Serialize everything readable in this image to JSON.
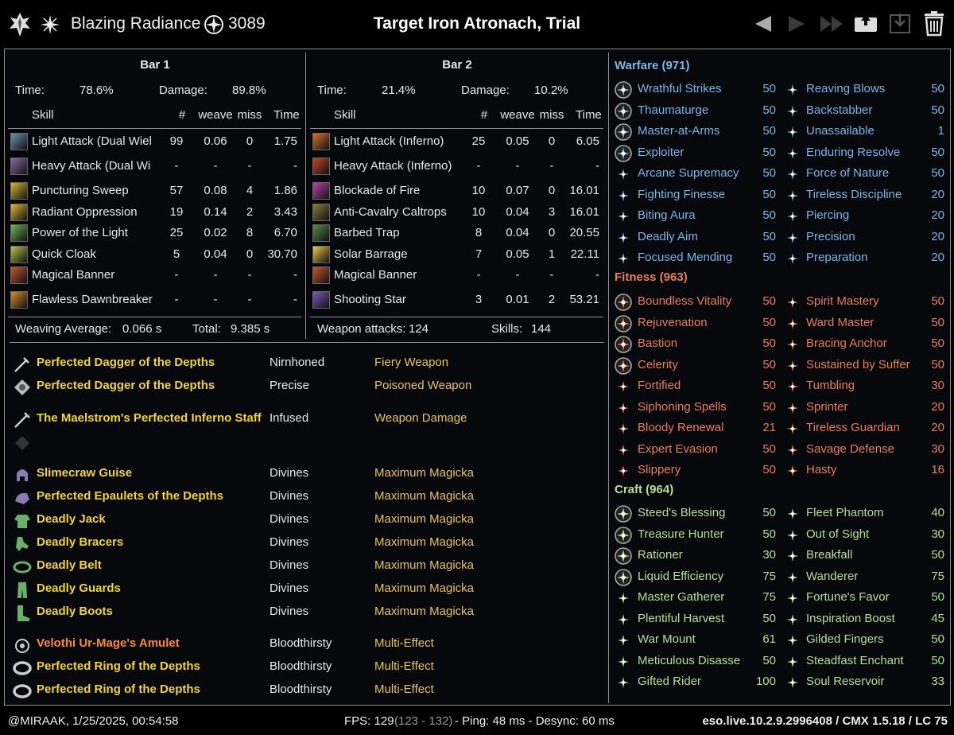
{
  "header": {
    "class_name": "Blazing Radiance",
    "cp_total": "3089",
    "title": "Target Iron Atronach, Trial"
  },
  "bars": [
    {
      "title": "Bar 1",
      "time_label": "Time:",
      "time": "78.6%",
      "damage_label": "Damage:",
      "damage": "89.8%",
      "columns": [
        "Skill",
        "#",
        "weave",
        "miss",
        "Time"
      ],
      "skills": [
        {
          "name": "Light Attack (Dual Wiel",
          "n": "99",
          "weave": "0.06",
          "miss": "0",
          "time": "1.75",
          "color": "#6f8fb0"
        },
        {
          "name": "Heavy Attack (Dual Wi",
          "n": "-",
          "weave": "-",
          "miss": "-",
          "time": "-",
          "color": "#8a6aa8"
        },
        {
          "name": "Puncturing Sweep",
          "n": "57",
          "weave": "0.08",
          "miss": "4",
          "time": "1.86",
          "color": "#d7b43a"
        },
        {
          "name": "Radiant Oppression",
          "n": "19",
          "weave": "0.14",
          "miss": "2",
          "time": "3.43",
          "color": "#e0b23a"
        },
        {
          "name": "Power of the Light",
          "n": "25",
          "weave": "0.02",
          "miss": "8",
          "time": "6.70",
          "color": "#6fb25a"
        },
        {
          "name": "Quick Cloak",
          "n": "5",
          "weave": "0.04",
          "miss": "0",
          "time": "30.70",
          "color": "#b9c24a"
        },
        {
          "name": "Magical Banner",
          "n": "-",
          "weave": "-",
          "miss": "-",
          "time": "-",
          "color": "#c4562e"
        },
        {
          "name": "Flawless Dawnbreaker",
          "n": "-",
          "weave": "-",
          "miss": "-",
          "time": "-",
          "color": "#d98b30"
        }
      ],
      "summary_left_label": "Weaving Average:",
      "summary_left_value": "0.066 s",
      "summary_right_label": "Total:",
      "summary_right_value": "9.385 s"
    },
    {
      "title": "Bar 2",
      "time_label": "Time:",
      "time": "21.4%",
      "damage_label": "Damage:",
      "damage": "10.2%",
      "columns": [
        "Skill",
        "#",
        "weave",
        "miss",
        "Time"
      ],
      "skills": [
        {
          "name": "Light Attack (Inferno)",
          "n": "25",
          "weave": "0.05",
          "miss": "0",
          "time": "6.05",
          "color": "#d9702a"
        },
        {
          "name": "Heavy Attack (Inferno)",
          "n": "-",
          "weave": "-",
          "miss": "-",
          "time": "-",
          "color": "#c4452a"
        },
        {
          "name": "Blockade of Fire",
          "n": "10",
          "weave": "0.07",
          "miss": "0",
          "time": "16.01",
          "color": "#b646a8"
        },
        {
          "name": "Anti-Cavalry Caltrops",
          "n": "10",
          "weave": "0.04",
          "miss": "3",
          "time": "16.01",
          "color": "#8a7a3a"
        },
        {
          "name": "Barbed Trap",
          "n": "8",
          "weave": "0.04",
          "miss": "0",
          "time": "20.55",
          "color": "#5a8a4a"
        },
        {
          "name": "Solar Barrage",
          "n": "7",
          "weave": "0.05",
          "miss": "1",
          "time": "22.11",
          "color": "#e8c84a"
        },
        {
          "name": "Magical Banner",
          "n": "-",
          "weave": "-",
          "miss": "-",
          "time": "-",
          "color": "#c4562e"
        },
        {
          "name": "Shooting Star",
          "n": "3",
          "weave": "0.01",
          "miss": "2",
          "time": "53.21",
          "color": "#7a5ab8"
        }
      ],
      "summary_left_label": "Weapon attacks:",
      "summary_left_value": "124",
      "summary_right_label": "Skills:",
      "summary_right_value": "144"
    }
  ],
  "gear": [
    {
      "name": "Perfected Dagger of the Depths",
      "trait": "Nirnhoned",
      "enchant": "Fiery Weapon",
      "icon": "dagger-icon",
      "rarity": "gold"
    },
    {
      "name": "Perfected Dagger of the Depths",
      "trait": "Precise",
      "enchant": "Poisoned Weapon",
      "icon": "poison-icon",
      "rarity": "gold"
    },
    {
      "name": "The Maelstrom's Perfected Inferno Staff",
      "trait": "Infused",
      "enchant": "Weapon Damage",
      "icon": "staff-icon",
      "rarity": "gold"
    },
    {
      "name": "",
      "trait": "",
      "enchant": "",
      "icon": "empty-slot-icon",
      "rarity": "none"
    },
    {
      "name": "Slimecraw Guise",
      "trait": "Divines",
      "enchant": "Maximum Magicka",
      "icon": "helmet-icon",
      "rarity": "gold"
    },
    {
      "name": "Perfected Epaulets of the Depths",
      "trait": "Divines",
      "enchant": "Maximum Magicka",
      "icon": "shoulder-icon",
      "rarity": "gold"
    },
    {
      "name": "Deadly Jack",
      "trait": "Divines",
      "enchant": "Maximum Magicka",
      "icon": "chest-icon",
      "rarity": "gold"
    },
    {
      "name": "Deadly Bracers",
      "trait": "Divines",
      "enchant": "Maximum Magicka",
      "icon": "gloves-icon",
      "rarity": "gold"
    },
    {
      "name": "Deadly Belt",
      "trait": "Divines",
      "enchant": "Maximum Magicka",
      "icon": "belt-icon",
      "rarity": "gold"
    },
    {
      "name": "Deadly Guards",
      "trait": "Divines",
      "enchant": "Maximum Magicka",
      "icon": "legs-icon",
      "rarity": "gold"
    },
    {
      "name": "Deadly Boots",
      "trait": "Divines",
      "enchant": "Maximum Magicka",
      "icon": "boots-icon",
      "rarity": "gold"
    },
    {
      "name": "Velothi Ur-Mage's Amulet",
      "trait": "Bloodthirsty",
      "enchant": "Multi-Effect",
      "icon": "amulet-icon",
      "rarity": "orange"
    },
    {
      "name": "Perfected Ring of the Depths",
      "trait": "Bloodthirsty",
      "enchant": "Multi-Effect",
      "icon": "ring-icon",
      "rarity": "gold"
    },
    {
      "name": "Perfected Ring of the Depths",
      "trait": "Bloodthirsty",
      "enchant": "Multi-Effect",
      "icon": "ring-icon",
      "rarity": "gold"
    }
  ],
  "cp": {
    "warfare": {
      "title": "Warfare (971)",
      "color": "#79b6e6",
      "left": [
        {
          "name": "Wrathful Strikes",
          "value": "50",
          "slotted": true
        },
        {
          "name": "Thaumaturge",
          "value": "50",
          "slotted": true
        },
        {
          "name": "Master-at-Arms",
          "value": "50",
          "slotted": true
        },
        {
          "name": "Exploiter",
          "value": "50",
          "slotted": true
        },
        {
          "name": "Arcane Supremacy",
          "value": "50",
          "slotted": false
        },
        {
          "name": "Fighting Finesse",
          "value": "50",
          "slotted": false
        },
        {
          "name": "Biting Aura",
          "value": "50",
          "slotted": false
        },
        {
          "name": "Deadly Aim",
          "value": "50",
          "slotted": false
        },
        {
          "name": "Focused Mending",
          "value": "50",
          "slotted": false
        }
      ],
      "right": [
        {
          "name": "Reaving Blows",
          "value": "50"
        },
        {
          "name": "Backstabber",
          "value": "50"
        },
        {
          "name": "Unassailable",
          "value": "1"
        },
        {
          "name": "Enduring Resolve",
          "value": "50"
        },
        {
          "name": "Force of Nature",
          "value": "50"
        },
        {
          "name": "Tireless Discipline",
          "value": "20"
        },
        {
          "name": "Piercing",
          "value": "20"
        },
        {
          "name": "Precision",
          "value": "20"
        },
        {
          "name": "Preparation",
          "value": "20"
        }
      ]
    },
    "fitness": {
      "title": "Fitness (963)",
      "color": "#ec7c56",
      "left": [
        {
          "name": "Boundless Vitality",
          "value": "50",
          "slotted": true
        },
        {
          "name": "Rejuvenation",
          "value": "50",
          "slotted": true
        },
        {
          "name": "Bastion",
          "value": "50",
          "slotted": true
        },
        {
          "name": "Celerity",
          "value": "50",
          "slotted": true
        },
        {
          "name": "Fortified",
          "value": "50",
          "slotted": false
        },
        {
          "name": "Siphoning Spells",
          "value": "50",
          "slotted": false
        },
        {
          "name": "Bloody Renewal",
          "value": "21",
          "slotted": false
        },
        {
          "name": "Expert Evasion",
          "value": "50",
          "slotted": false
        },
        {
          "name": "Slippery",
          "value": "50",
          "slotted": false
        }
      ],
      "right": [
        {
          "name": "Spirit Mastery",
          "value": "50"
        },
        {
          "name": "Ward Master",
          "value": "50"
        },
        {
          "name": "Bracing Anchor",
          "value": "50"
        },
        {
          "name": "Sustained by Suffer",
          "value": "50"
        },
        {
          "name": "Tumbling",
          "value": "30"
        },
        {
          "name": "Sprinter",
          "value": "20"
        },
        {
          "name": "Tireless Guardian",
          "value": "20"
        },
        {
          "name": "Savage Defense",
          "value": "30"
        },
        {
          "name": "Hasty",
          "value": "16"
        }
      ]
    },
    "craft": {
      "title": "Craft (964)",
      "color": "#b3e08d",
      "left": [
        {
          "name": "Steed's Blessing",
          "value": "50",
          "slotted": true
        },
        {
          "name": "Treasure Hunter",
          "value": "50",
          "slotted": true
        },
        {
          "name": "Rationer",
          "value": "30",
          "slotted": true
        },
        {
          "name": "Liquid Efficiency",
          "value": "75",
          "slotted": true
        },
        {
          "name": "Master Gatherer",
          "value": "75",
          "slotted": false
        },
        {
          "name": "Plentiful Harvest",
          "value": "50",
          "slotted": false
        },
        {
          "name": "War Mount",
          "value": "61",
          "slotted": false
        },
        {
          "name": "Meticulous Disasse",
          "value": "50",
          "slotted": false
        },
        {
          "name": "Gifted Rider",
          "value": "100",
          "slotted": false
        }
      ],
      "right": [
        {
          "name": "Fleet Phantom",
          "value": "40"
        },
        {
          "name": "Out of Sight",
          "value": "30"
        },
        {
          "name": "Breakfall",
          "value": "50"
        },
        {
          "name": "Wanderer",
          "value": "75"
        },
        {
          "name": "Fortune's Favor",
          "value": "50"
        },
        {
          "name": "Inspiration Boost",
          "value": "45"
        },
        {
          "name": "Gilded Fingers",
          "value": "50"
        },
        {
          "name": "Steadfast Enchant",
          "value": "50"
        },
        {
          "name": "Soul Reservoir",
          "value": "33"
        }
      ]
    }
  },
  "footer": {
    "user_date": "@MIRAAK, 1/25/2025, 00:54:58",
    "fps_label": "FPS: 129",
    "fps_range": "(123 - 132)",
    "ping_desync": "- Ping: 48 ms - Desync: 60 ms",
    "version": "eso.live.10.2.9.2996408 / CMX 1.5.18 / LC 75"
  }
}
